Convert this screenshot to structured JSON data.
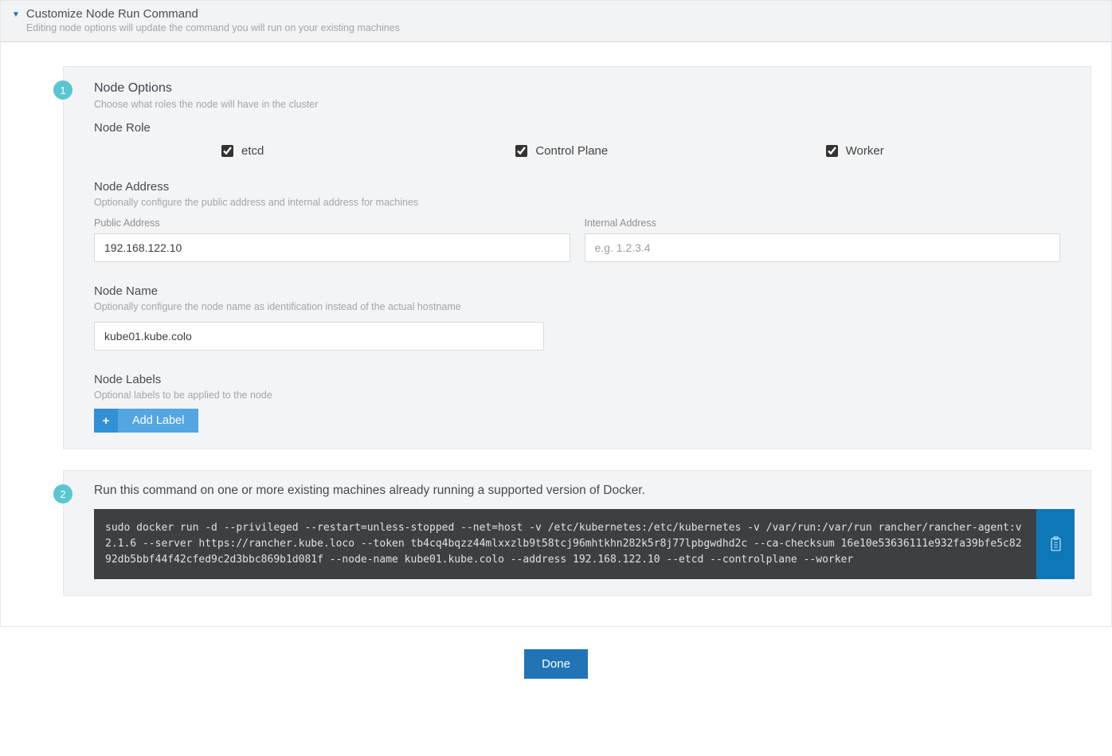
{
  "header": {
    "title": "Customize Node Run Command",
    "subtitle": "Editing node options will update the command you will run on your existing machines"
  },
  "step1": {
    "badge": "1",
    "title": "Node Options",
    "subtitle": "Choose what roles the node will have in the cluster",
    "node_role_heading": "Node Role",
    "roles": {
      "etcd_label": "etcd",
      "control_plane_label": "Control Plane",
      "worker_label": "Worker"
    },
    "node_address": {
      "heading": "Node Address",
      "subtitle": "Optionally configure the public address and internal address for machines",
      "public_label": "Public Address",
      "public_value": "192.168.122.10",
      "internal_label": "Internal Address",
      "internal_placeholder": "e.g. 1.2.3.4",
      "internal_value": ""
    },
    "node_name": {
      "heading": "Node Name",
      "subtitle": "Optionally configure the node name as identification instead of the actual hostname",
      "value": "kube01.kube.colo"
    },
    "node_labels": {
      "heading": "Node Labels",
      "subtitle": "Optional labels to be applied to the node",
      "add_label": "Add Label"
    }
  },
  "step2": {
    "badge": "2",
    "title": "Run this command on one or more existing machines already running a supported version of Docker.",
    "command": "sudo docker run -d --privileged --restart=unless-stopped --net=host -v /etc/kubernetes:/etc/kubernetes -v /var/run:/var/run rancher/rancher-agent:v2.1.6 --server https://rancher.kube.loco --token tb4cq4bqzz44mlxxzlb9t58tcj96mhtkhn282k5r8j77lpbgwdhd2c --ca-checksum 16e10e53636111e932fa39bfe5c8292db5bbf44f42cfed9c2d3bbc869b1d081f --node-name kube01.kube.colo --address 192.168.122.10 --etcd --controlplane --worker"
  },
  "footer": {
    "done_label": "Done"
  }
}
